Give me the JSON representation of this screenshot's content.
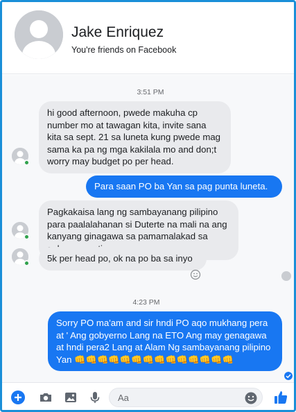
{
  "header": {
    "contact_name": "Jake Enriquez",
    "subtitle": "You're friends on Facebook"
  },
  "chat": {
    "timestamps": [
      "3:51 PM",
      "4:23 PM"
    ],
    "messages": [
      {
        "direction": "incoming",
        "text": "hi good afternoon, pwede makuha cp number mo at tawagan kita, invite sana kita sa sept. 21 sa luneta kung pwede mag sama ka pa ng mga kakilala mo and don;t worry may budget po per head."
      },
      {
        "direction": "outgoing",
        "text": "Para saan PO ba Yan sa pag punta luneta."
      },
      {
        "direction": "incoming",
        "text": "Pagkakaisa lang ng sambayanang pilipino para paalalahanan si Duterte na mali na ang kanyang ginagawa sa pamamalakad sa gobyerno natin"
      },
      {
        "direction": "incoming",
        "text": "5k per head po, ok na po ba sa inyo"
      },
      {
        "direction": "outgoing",
        "text": "Sorry PO ma'am and sir hndi PO aqo mukhang pera at ' Ang gobyerno Lang na ETO Ang may genagawa at hndi pera2 Lang at Alam Ng sambayanang pilipino Yan 👊👊👊👊👊👊👊👊👊👊👊👊👊👊"
      }
    ]
  },
  "composer": {
    "placeholder": "Aa",
    "icons": [
      "plus-icon",
      "camera-icon",
      "image-icon",
      "microphone-icon",
      "emoji-icon",
      "thumbs-up-icon"
    ]
  },
  "colors": {
    "accent": "#1877f2",
    "incoming_bubble": "#e9eaed",
    "online": "#31a24c",
    "frame_border": "#1a8fd8"
  }
}
